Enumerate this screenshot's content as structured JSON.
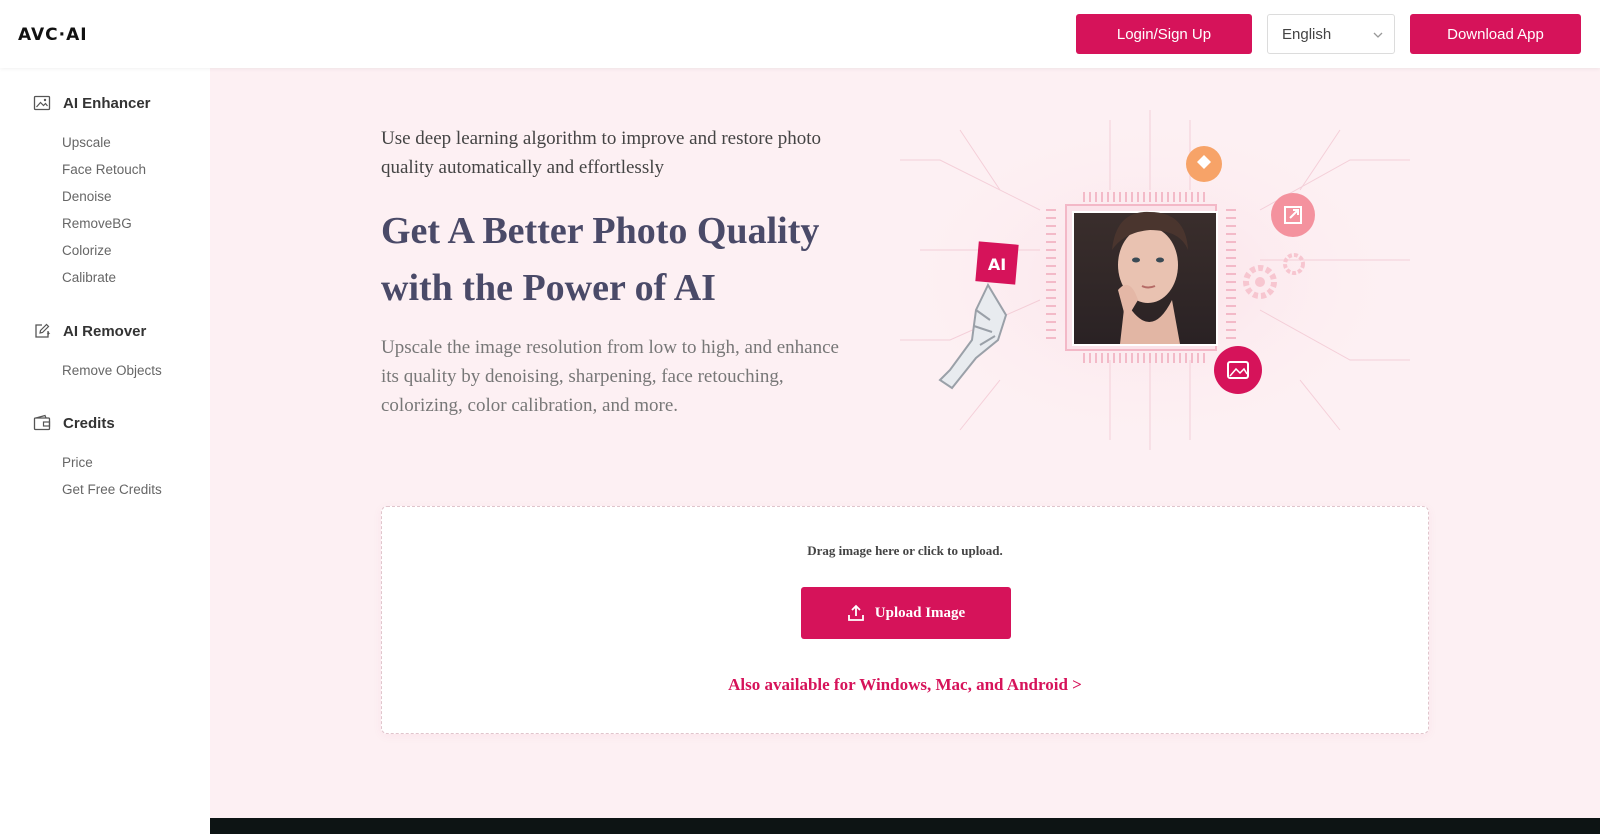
{
  "header": {
    "logo": "AVC·AI",
    "login_label": "Login/Sign Up",
    "language": "English",
    "download_label": "Download App"
  },
  "sidebar": {
    "sections": [
      {
        "title": "AI Enhancer",
        "icon": "image-icon",
        "items": [
          "Upscale",
          "Face Retouch",
          "Denoise",
          "RemoveBG",
          "Colorize",
          "Calibrate"
        ]
      },
      {
        "title": "AI Remover",
        "icon": "edit-sparkle-icon",
        "items": [
          "Remove Objects"
        ]
      },
      {
        "title": "Credits",
        "icon": "wallet-icon",
        "items": [
          "Price",
          "Get Free Credits"
        ]
      }
    ]
  },
  "hero": {
    "subtitle": "Use deep learning algorithm to improve and restore photo quality automatically and effortlessly",
    "title": "Get A Better Photo Quality with the Power of AI",
    "description": "Upscale the image resolution from low to high, and enhance its quality by denoising, sharpening, face retouching, colorizing, color calibration, and more.",
    "illustration_badge": "AI"
  },
  "upload": {
    "drag_text": "Drag image here or click to upload.",
    "button_label": "Upload Image",
    "also_link": "Also available for Windows, Mac, and Android >"
  },
  "colors": {
    "accent": "#d6135a",
    "background": "#fdf0f3",
    "orange": "#f7a368",
    "pink_light": "#f4929e"
  }
}
